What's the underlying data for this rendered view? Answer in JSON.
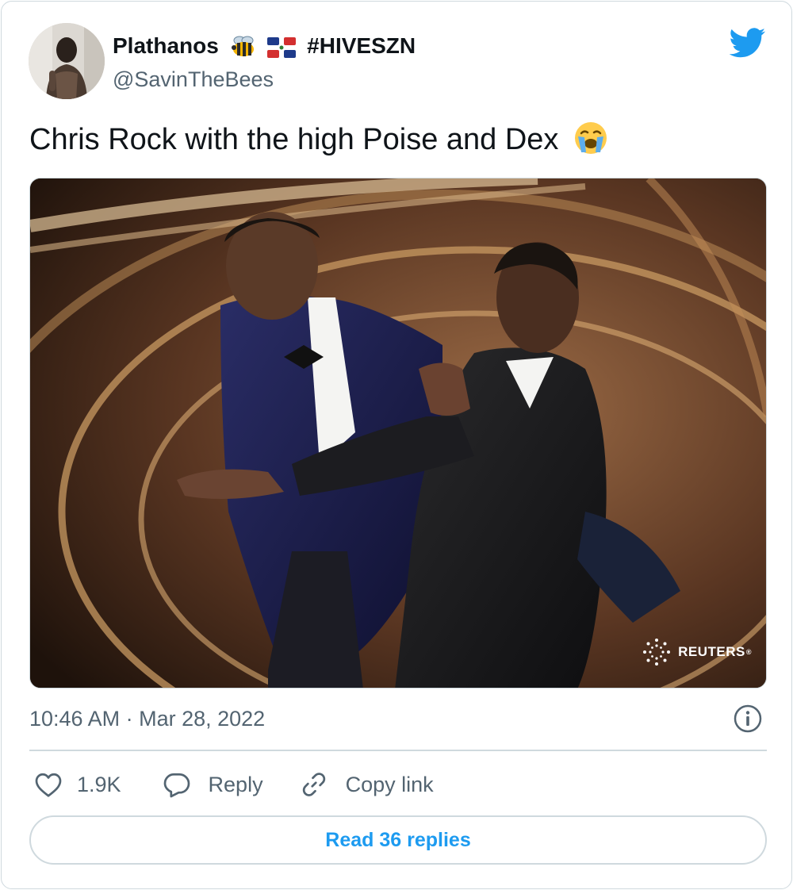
{
  "user": {
    "display_name": "Plathanos",
    "name_emojis": [
      "bee",
      "dominican-republic-flag"
    ],
    "hashtag": "#HIVESZN",
    "handle": "@SavinTheBees"
  },
  "tweet": {
    "text": "Chris Rock with the high Poise and Dex",
    "text_emoji": "loudly-crying-face",
    "media_credit": "REUTERS",
    "timestamp": "10:46 AM · Mar 28, 2022"
  },
  "actions": {
    "like_count": "1.9K",
    "reply_label": "Reply",
    "copy_link_label": "Copy link"
  },
  "footer": {
    "read_replies_label": "Read 36 replies"
  },
  "colors": {
    "twitter_blue": "#1d9bf0",
    "secondary_text": "#536471",
    "border": "#cfd9de"
  },
  "icons": [
    "twitter-bird-icon",
    "info-icon",
    "heart-icon",
    "reply-bubble-icon",
    "link-icon"
  ]
}
